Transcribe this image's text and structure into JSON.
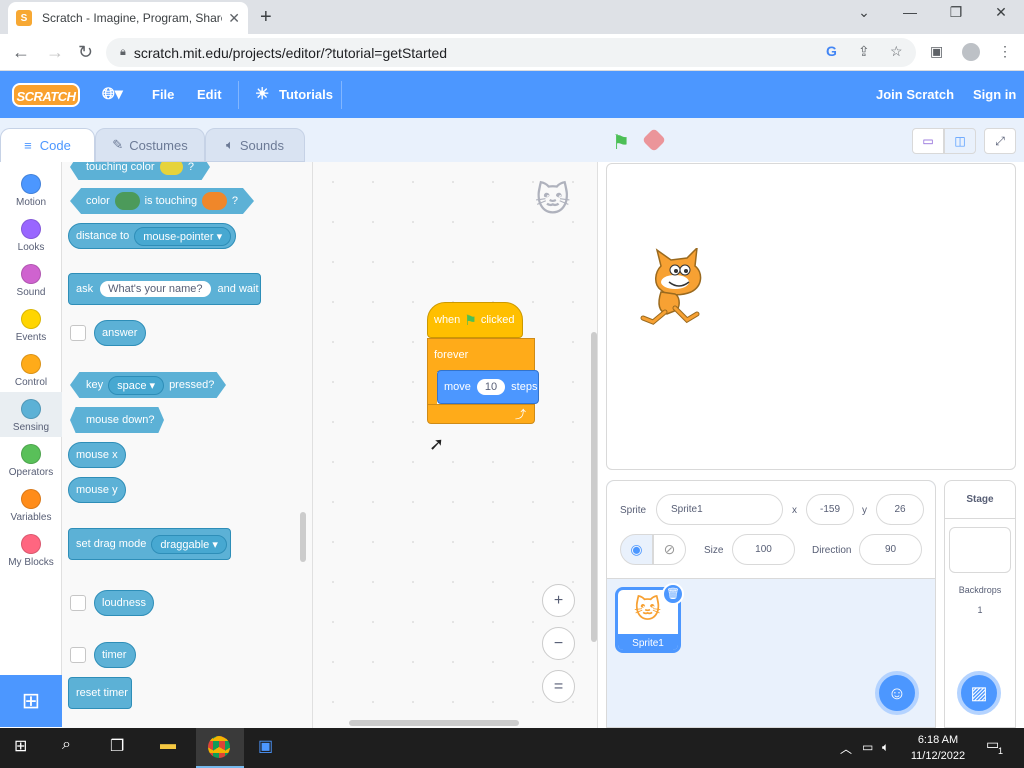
{
  "browser": {
    "tab_title": "Scratch - Imagine, Program, Share",
    "favicon_letter": "S",
    "url": "scratch.mit.edu/projects/editor/?tutorial=getStarted"
  },
  "menu": {
    "logo": "SCRATCH",
    "file": "File",
    "edit": "Edit",
    "tutorials": "Tutorials",
    "join": "Join Scratch",
    "signin": "Sign in"
  },
  "tabs": {
    "code": "Code",
    "costumes": "Costumes",
    "sounds": "Sounds"
  },
  "categories": [
    {
      "label": "Motion",
      "color": "#4c97ff"
    },
    {
      "label": "Looks",
      "color": "#9966ff"
    },
    {
      "label": "Sound",
      "color": "#cf63cf"
    },
    {
      "label": "Events",
      "color": "#ffd500"
    },
    {
      "label": "Control",
      "color": "#ffab19"
    },
    {
      "label": "Sensing",
      "color": "#5cb1d6"
    },
    {
      "label": "Operators",
      "color": "#59c059"
    },
    {
      "label": "Variables",
      "color": "#ff8c1a"
    },
    {
      "label": "My Blocks",
      "color": "#ff6680"
    }
  ],
  "palette": {
    "touching_color": "touching color",
    "color": "color",
    "is_touching": "is touching",
    "q": "?",
    "distance_to": "distance to",
    "mouse_pointer": "mouse-pointer",
    "ask": "ask",
    "whats_your_name": "What's your name?",
    "and_wait": "and wait",
    "answer": "answer",
    "key": "key",
    "space": "space",
    "pressed": "pressed?",
    "mouse_down": "mouse down?",
    "mouse_x": "mouse x",
    "mouse_y": "mouse y",
    "set_drag_mode": "set drag mode",
    "draggable": "draggable",
    "loudness": "loudness",
    "timer": "timer",
    "reset_timer": "reset timer"
  },
  "script": {
    "when": "when",
    "clicked": "clicked",
    "forever": "forever",
    "move": "move",
    "steps_value": "10",
    "steps": "steps"
  },
  "zoom": {
    "in": "+",
    "out": "−",
    "reset": "="
  },
  "sprite_info": {
    "sprite_label": "Sprite",
    "sprite_name": "Sprite1",
    "x_label": "x",
    "x_value": "-159",
    "y_label": "y",
    "y_value": "26",
    "size_label": "Size",
    "size_value": "100",
    "direction_label": "Direction",
    "direction_value": "90"
  },
  "sprite_thumb": {
    "name": "Sprite1"
  },
  "stage_pane": {
    "title": "Stage",
    "backdrops_label": "Backdrops",
    "backdrops_count": "1"
  },
  "taskbar": {
    "time": "6:18 AM",
    "date": "11/12/2022",
    "notifications": "1"
  }
}
